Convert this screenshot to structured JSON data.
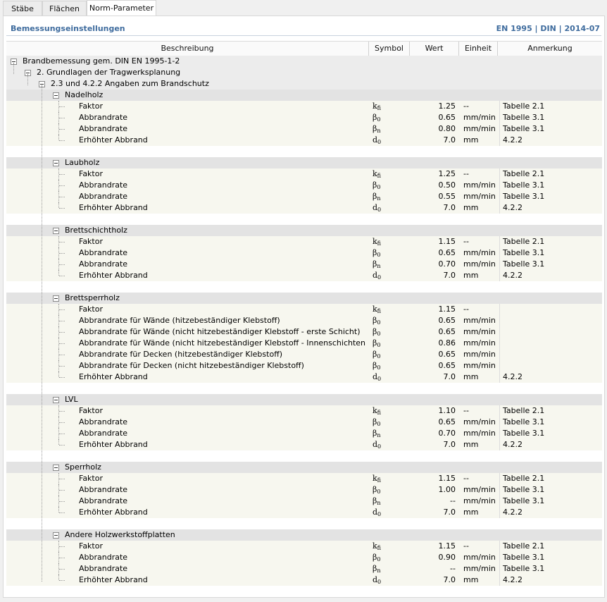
{
  "tabs": [
    {
      "label": "Stäbe",
      "active": false
    },
    {
      "label": "Flächen",
      "active": false
    },
    {
      "label": "Norm-Parameter",
      "active": true
    }
  ],
  "header": {
    "title": "Bemessungseinstellungen",
    "norm": "EN 1995 | DIN | 2014-07"
  },
  "columns": {
    "beschreibung": "Beschreibung",
    "symbol": "Symbol",
    "wert": "Wert",
    "einheit": "Einheit",
    "anmerkung": "Anmerkung"
  },
  "tree": {
    "root": "Brandbemessung gem. DIN EN 1995-1-2",
    "level1": "2. Grundlagen der Tragwerksplanung",
    "level2": "2.3 und 4.2.2 Angaben zum Brandschutz"
  },
  "groups": [
    {
      "name": "Nadelholz",
      "params": [
        {
          "desc": "Faktor",
          "sym": "k",
          "sub": "fi",
          "val": "1.25",
          "unit": "--",
          "note": "Tabelle 2.1"
        },
        {
          "desc": "Abbrandrate",
          "sym": "β",
          "sub": "0",
          "val": "0.65",
          "unit": "mm/min",
          "note": "Tabelle 3.1"
        },
        {
          "desc": "Abbrandrate",
          "sym": "β",
          "sub": "n",
          "val": "0.80",
          "unit": "mm/min",
          "note": "Tabelle 3.1"
        },
        {
          "desc": "Erhöhter Abbrand",
          "sym": "d",
          "sub": "0",
          "val": "7.0",
          "unit": "mm",
          "note": "4.2.2"
        }
      ]
    },
    {
      "name": "Laubholz",
      "params": [
        {
          "desc": "Faktor",
          "sym": "k",
          "sub": "fi",
          "val": "1.25",
          "unit": "--",
          "note": "Tabelle 2.1"
        },
        {
          "desc": "Abbrandrate",
          "sym": "β",
          "sub": "0",
          "val": "0.50",
          "unit": "mm/min",
          "note": "Tabelle 3.1"
        },
        {
          "desc": "Abbrandrate",
          "sym": "β",
          "sub": "n",
          "val": "0.55",
          "unit": "mm/min",
          "note": "Tabelle 3.1"
        },
        {
          "desc": "Erhöhter Abbrand",
          "sym": "d",
          "sub": "0",
          "val": "7.0",
          "unit": "mm",
          "note": "4.2.2"
        }
      ]
    },
    {
      "name": "Brettschichtholz",
      "params": [
        {
          "desc": "Faktor",
          "sym": "k",
          "sub": "fi",
          "val": "1.15",
          "unit": "--",
          "note": "Tabelle 2.1"
        },
        {
          "desc": "Abbrandrate",
          "sym": "β",
          "sub": "0",
          "val": "0.65",
          "unit": "mm/min",
          "note": "Tabelle 3.1"
        },
        {
          "desc": "Abbrandrate",
          "sym": "β",
          "sub": "n",
          "val": "0.70",
          "unit": "mm/min",
          "note": "Tabelle 3.1"
        },
        {
          "desc": "Erhöhter Abbrand",
          "sym": "d",
          "sub": "0",
          "val": "7.0",
          "unit": "mm",
          "note": "4.2.2"
        }
      ]
    },
    {
      "name": "Brettsperrholz",
      "params": [
        {
          "desc": "Faktor",
          "sym": "k",
          "sub": "fi",
          "val": "1.15",
          "unit": "--",
          "note": ""
        },
        {
          "desc": "Abbrandrate für Wände (hitzebeständiger Klebstoff)",
          "sym": "β",
          "sub": "0",
          "val": "0.65",
          "unit": "mm/min",
          "note": ""
        },
        {
          "desc": "Abbrandrate für Wände (nicht hitzebeständiger Klebstoff - erste Schicht)",
          "sym": "β",
          "sub": "0",
          "val": "0.65",
          "unit": "mm/min",
          "note": ""
        },
        {
          "desc": "Abbrandrate für Wände (nicht hitzebeständiger Klebstoff - Innenschichten)",
          "sym": "β",
          "sub": "0",
          "val": "0.86",
          "unit": "mm/min",
          "note": ""
        },
        {
          "desc": "Abbrandrate für Decken (hitzebeständiger Klebstoff)",
          "sym": "β",
          "sub": "0",
          "val": "0.65",
          "unit": "mm/min",
          "note": ""
        },
        {
          "desc": "Abbrandrate für Decken (nicht hitzebeständiger Klebstoff)",
          "sym": "β",
          "sub": "0",
          "val": "0.65",
          "unit": "mm/min",
          "note": ""
        },
        {
          "desc": "Erhöhter Abbrand",
          "sym": "d",
          "sub": "0",
          "val": "7.0",
          "unit": "mm",
          "note": "4.2.2"
        }
      ]
    },
    {
      "name": "LVL",
      "params": [
        {
          "desc": "Faktor",
          "sym": "k",
          "sub": "fi",
          "val": "1.10",
          "unit": "--",
          "note": "Tabelle 2.1"
        },
        {
          "desc": "Abbrandrate",
          "sym": "β",
          "sub": "0",
          "val": "0.65",
          "unit": "mm/min",
          "note": "Tabelle 3.1"
        },
        {
          "desc": "Abbrandrate",
          "sym": "β",
          "sub": "n",
          "val": "0.70",
          "unit": "mm/min",
          "note": "Tabelle 3.1"
        },
        {
          "desc": "Erhöhter Abbrand",
          "sym": "d",
          "sub": "0",
          "val": "7.0",
          "unit": "mm",
          "note": "4.2.2"
        }
      ]
    },
    {
      "name": "Sperrholz",
      "params": [
        {
          "desc": "Faktor",
          "sym": "k",
          "sub": "fi",
          "val": "1.15",
          "unit": "--",
          "note": "Tabelle 2.1"
        },
        {
          "desc": "Abbrandrate",
          "sym": "β",
          "sub": "0",
          "val": "1.00",
          "unit": "mm/min",
          "note": "Tabelle 3.1"
        },
        {
          "desc": "Abbrandrate",
          "sym": "β",
          "sub": "n",
          "val": "--",
          "unit": "mm/min",
          "note": "Tabelle 3.1"
        },
        {
          "desc": "Erhöhter Abbrand",
          "sym": "d",
          "sub": "0",
          "val": "7.0",
          "unit": "mm",
          "note": "4.2.2"
        }
      ]
    },
    {
      "name": "Andere Holzwerkstoffplatten",
      "params": [
        {
          "desc": "Faktor",
          "sym": "k",
          "sub": "fi",
          "val": "1.15",
          "unit": "--",
          "note": "Tabelle 2.1"
        },
        {
          "desc": "Abbrandrate",
          "sym": "β",
          "sub": "0",
          "val": "0.90",
          "unit": "mm/min",
          "note": "Tabelle 3.1"
        },
        {
          "desc": "Abbrandrate",
          "sym": "β",
          "sub": "n",
          "val": "--",
          "unit": "mm/min",
          "note": "Tabelle 3.1"
        },
        {
          "desc": "Erhöhter Abbrand",
          "sym": "d",
          "sub": "0",
          "val": "7.0",
          "unit": "mm",
          "note": "4.2.2"
        }
      ]
    }
  ]
}
